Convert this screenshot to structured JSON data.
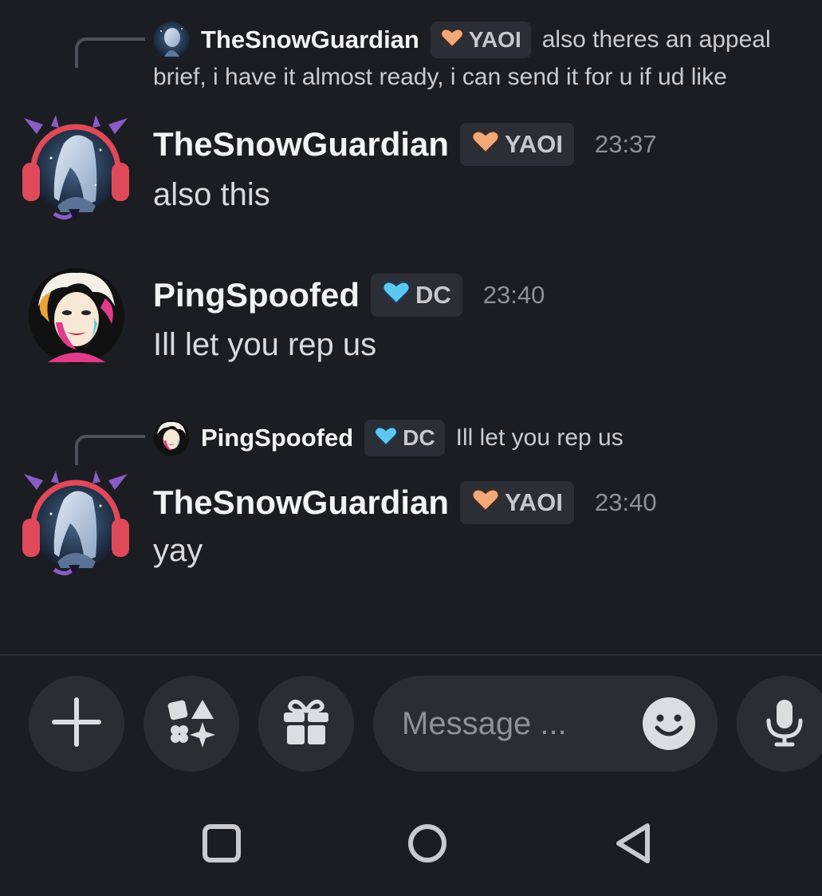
{
  "messages": [
    {
      "reply": {
        "author": "TheSnowGuardian",
        "tag": "YAOI",
        "text_line1": "also theres an appeal",
        "text_line2": "brief, i have it almost ready, i can send it for u if ud like"
      },
      "author": "TheSnowGuardian",
      "tag": "YAOI",
      "time": "23:37",
      "content": "also this"
    },
    {
      "author": "PingSpoofed",
      "tag": "DC",
      "time": "23:40",
      "content": "Ill let you rep us"
    },
    {
      "reply": {
        "author": "PingSpoofed",
        "tag": "DC",
        "text_line1": "Ill let you rep us"
      },
      "author": "TheSnowGuardian",
      "tag": "YAOI",
      "time": "23:40",
      "content": "yay"
    }
  ],
  "composer": {
    "placeholder": "Message ...",
    "buttons": [
      "plus-icon",
      "apps-icon",
      "gift-icon",
      "emoji-icon",
      "microphone-icon"
    ]
  },
  "navbar": {
    "buttons": [
      "recents-icon",
      "home-icon",
      "back-icon"
    ]
  },
  "colors": {
    "background": "#1c1d22",
    "yaoi_heart": "#f3a877",
    "dc_heart": "#5cc8f2",
    "tag_bg": "#2c2e35",
    "timestamp": "#8e9199"
  }
}
